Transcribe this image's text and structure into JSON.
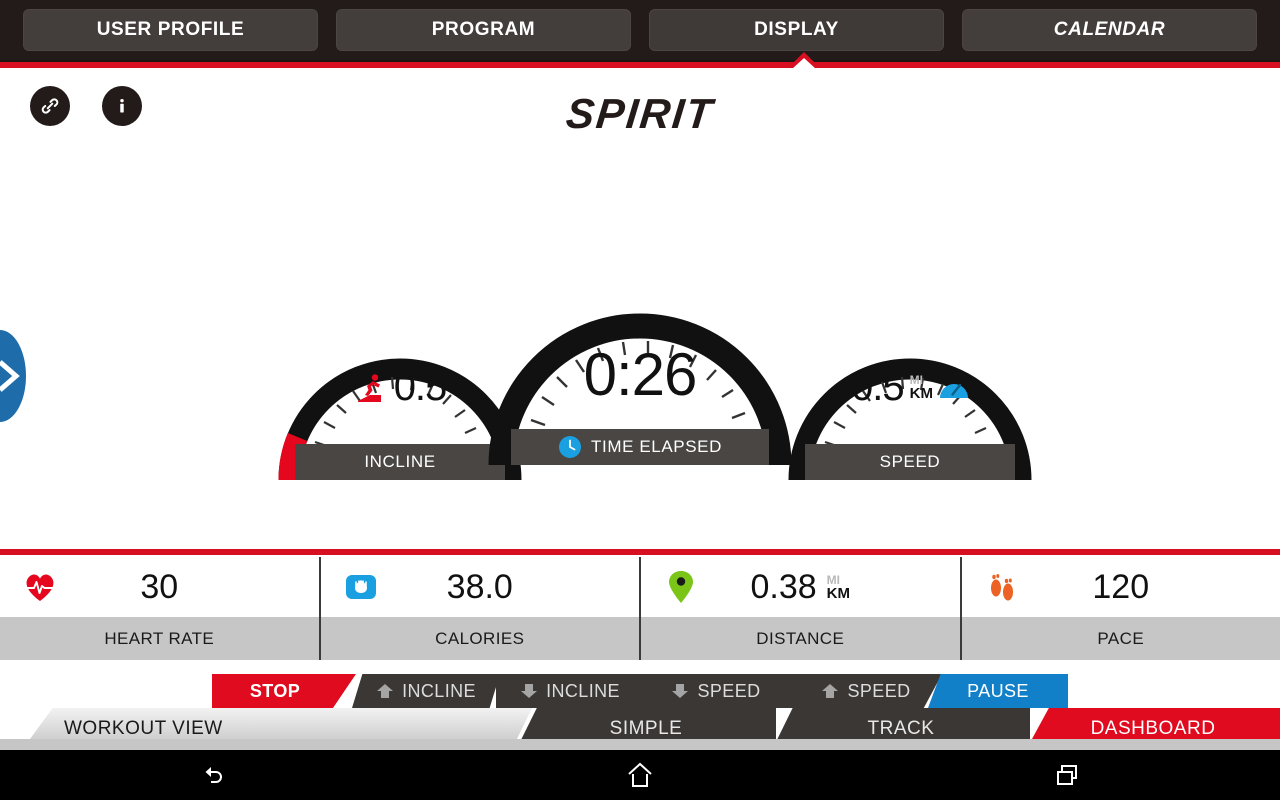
{
  "topbar": {
    "tabs": [
      {
        "label": "USER PROFILE",
        "name": "user-profile",
        "active": false,
        "italic": false
      },
      {
        "label": "PROGRAM",
        "name": "program",
        "active": false,
        "italic": false
      },
      {
        "label": "DISPLAY",
        "name": "display",
        "active": true,
        "italic": false
      },
      {
        "label": "CALENDAR",
        "name": "calendar",
        "active": false,
        "italic": true
      }
    ]
  },
  "header": {
    "logo": "SPIRIT",
    "link_icon": "link-icon",
    "info_icon": "info-icon"
  },
  "edge": {
    "arrow_icon": "chevron-right-icon"
  },
  "gauges": [
    {
      "id": "incline",
      "label": "INCLINE",
      "value": "0.5",
      "icon": "runner-incline-icon",
      "unit_primary": "",
      "unit_secondary": "",
      "arc_color": "#e4071e",
      "arc_percent": 18
    },
    {
      "id": "time-elapsed",
      "label": "TIME ELAPSED",
      "value": "0:26",
      "icon": "clock-icon",
      "unit_primary": "",
      "unit_secondary": "",
      "arc_color": "#111111",
      "arc_percent": 0
    },
    {
      "id": "speed",
      "label": "SPEED",
      "value": "0.5",
      "icon": "speedometer-icon",
      "unit_primary": "MI",
      "unit_secondary": "KM",
      "arc_color": "#111111",
      "arc_percent": 0
    }
  ],
  "metrics": [
    {
      "id": "heart-rate",
      "label": "HEART RATE",
      "value": "30",
      "icon": "heart-rate-icon",
      "unit_primary": "",
      "unit_secondary": "",
      "icon_color": "#e4071e"
    },
    {
      "id": "calories",
      "label": "CALORIES",
      "value": "38.0",
      "icon": "flame-icon",
      "unit_primary": "",
      "unit_secondary": "",
      "icon_color": "#1aa0e0"
    },
    {
      "id": "distance",
      "label": "DISTANCE",
      "value": "0.38",
      "icon": "location-pin-icon",
      "unit_primary": "MI",
      "unit_secondary": "KM",
      "icon_color": "#7ac518"
    },
    {
      "id": "pace",
      "label": "PACE",
      "value": "120",
      "icon": "footprints-icon",
      "unit_primary": "",
      "unit_secondary": "",
      "icon_color": "#ec6225"
    }
  ],
  "controls": [
    {
      "id": "stop",
      "label": "STOP",
      "icon": "",
      "color": "#e00b1e"
    },
    {
      "id": "incline-up",
      "label": "INCLINE",
      "icon": "arrow-up-icon",
      "color": "#3b3735"
    },
    {
      "id": "incline-down",
      "label": "INCLINE",
      "icon": "arrow-down-icon",
      "color": "#3b3735"
    },
    {
      "id": "speed-down",
      "label": "SPEED",
      "icon": "arrow-down-icon",
      "color": "#3b3735"
    },
    {
      "id": "speed-up",
      "label": "SPEED",
      "icon": "arrow-up-icon",
      "color": "#3b3735"
    },
    {
      "id": "pause",
      "label": "PAUSE",
      "icon": "",
      "color": "#1180c8"
    }
  ],
  "viewtabs": {
    "title": "WORKOUT VIEW",
    "items": [
      {
        "id": "simple",
        "label": "SIMPLE",
        "active": false
      },
      {
        "id": "track",
        "label": "TRACK",
        "active": false
      },
      {
        "id": "dashboard",
        "label": "DASHBOARD",
        "active": true
      }
    ]
  },
  "navbar": {
    "back": "back-icon",
    "home": "home-icon",
    "recents": "recents-icon"
  },
  "colors": {
    "brand_red": "#d80f20",
    "accent_blue": "#1180c8",
    "dark": "#231b19",
    "panel_grey": "#c6c6c6"
  }
}
